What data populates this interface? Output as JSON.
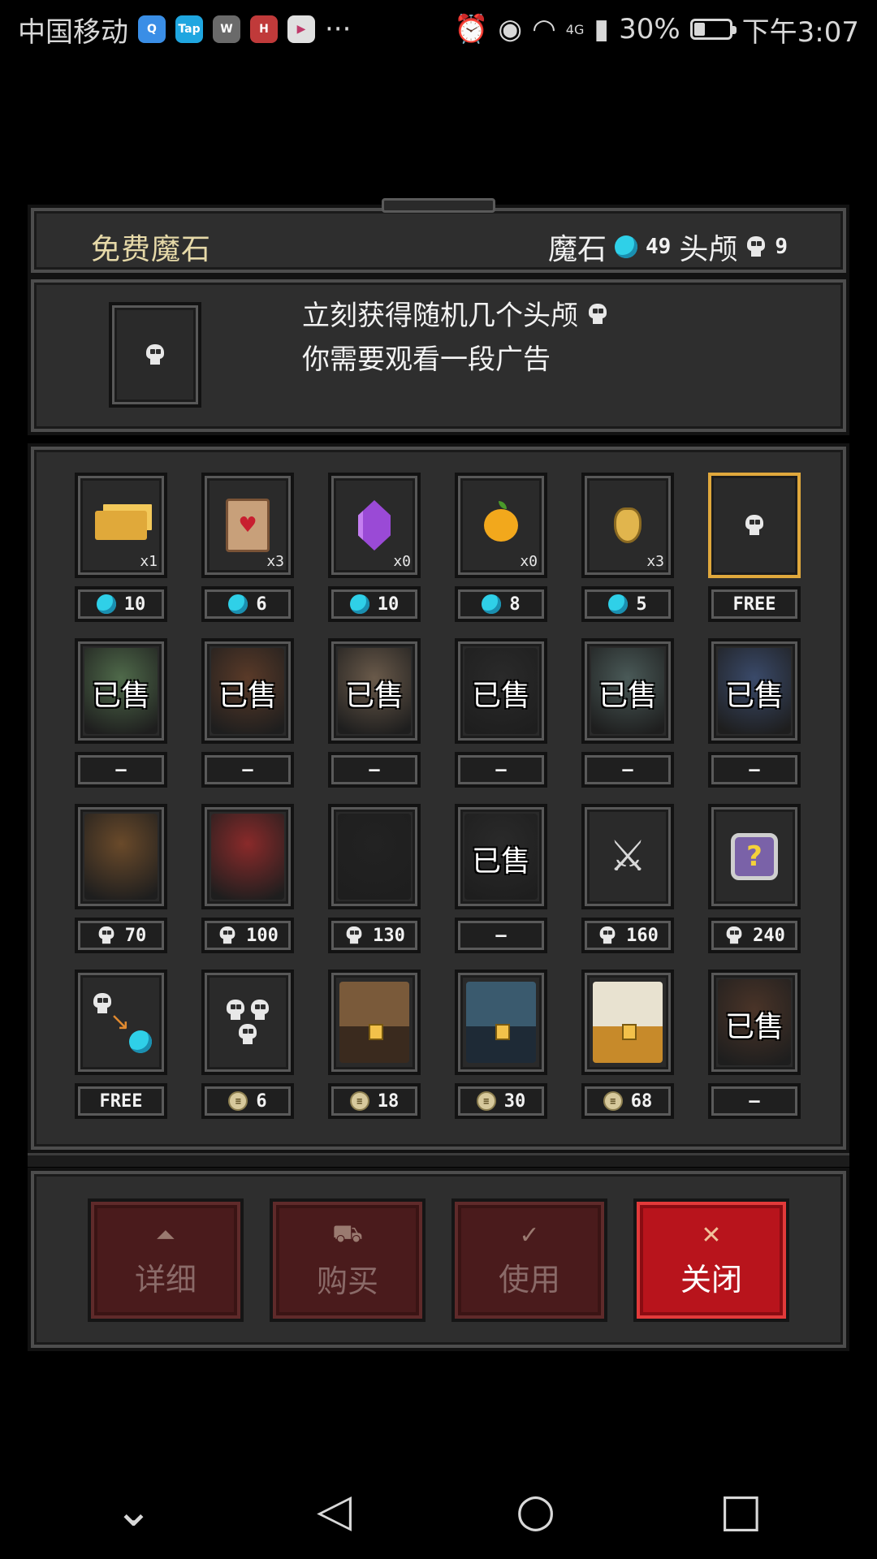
{
  "status_bar": {
    "carrier": "中国移动",
    "more": "···",
    "network": "4G",
    "battery_text": "30%",
    "battery_level": 0.3,
    "time": "下午3:07",
    "apps": [
      "qq-icon",
      "taptap-icon",
      "wechat-icon",
      "huawei-icon",
      "video-icon"
    ]
  },
  "header": {
    "title": "免费魔石",
    "gem_label": "魔石",
    "gem_count": "49",
    "skull_label": "头颅",
    "skull_count": "9"
  },
  "info": {
    "line1": "立刻获得随机几个头颅",
    "line2": "你需要观看一段广告"
  },
  "sold_label": "已售",
  "shop_rows": [
    [
      {
        "art": "gold-bars",
        "qty": "x1",
        "price_type": "gem",
        "price": "10"
      },
      {
        "art": "heart-scroll",
        "qty": "x3",
        "price_type": "gem",
        "price": "6"
      },
      {
        "art": "purple-crystal",
        "qty": "x0",
        "price_type": "gem",
        "price": "10"
      },
      {
        "art": "golden-apple",
        "qty": "x0",
        "price_type": "gem",
        "price": "8"
      },
      {
        "art": "skull-amulet",
        "qty": "x3",
        "price_type": "gem",
        "price": "5"
      },
      {
        "art": "skull",
        "qty": "",
        "price_type": "text",
        "price": "FREE",
        "selected": true
      }
    ],
    [
      {
        "art": "slime-character",
        "sold": true,
        "price_type": "text",
        "price": "—"
      },
      {
        "art": "treant-character",
        "sold": true,
        "price_type": "text",
        "price": "—"
      },
      {
        "art": "skeleton-character",
        "sold": true,
        "price_type": "text",
        "price": "—"
      },
      {
        "art": "hooded-character",
        "sold": true,
        "price_type": "text",
        "price": "—"
      },
      {
        "art": "zombie-character",
        "sold": true,
        "price_type": "text",
        "price": "—"
      },
      {
        "art": "witch-character",
        "sold": true,
        "price_type": "text",
        "price": "—"
      }
    ],
    [
      {
        "art": "forest-guardian-character",
        "price_type": "skull",
        "price": "70"
      },
      {
        "art": "vampire-girl-character",
        "price_type": "skull",
        "price": "100"
      },
      {
        "art": "reaper-character",
        "price_type": "skull",
        "price": "130"
      },
      {
        "art": "dark-mage-character",
        "sold": true,
        "price_type": "text",
        "price": "—"
      },
      {
        "art": "crossed-swords",
        "price_type": "skull",
        "price": "160"
      },
      {
        "art": "mystery-box",
        "price_type": "skull",
        "price": "240"
      }
    ],
    [
      {
        "art": "skull-to-gem",
        "price_type": "text",
        "price": "FREE"
      },
      {
        "art": "three-skulls",
        "price_type": "coin",
        "price": "6"
      },
      {
        "art": "wooden-chest",
        "price_type": "coin",
        "price": "18"
      },
      {
        "art": "blue-chest",
        "price_type": "coin",
        "price": "30"
      },
      {
        "art": "golden-chest",
        "price_type": "coin",
        "price": "68"
      },
      {
        "art": "hooded-figure-chest",
        "sold": true,
        "price_type": "text",
        "price": "—"
      }
    ]
  ],
  "buttons": [
    {
      "name": "details-button",
      "label": "详细",
      "icon": "bag-icon",
      "glyph": "⏶",
      "active": false
    },
    {
      "name": "buy-button",
      "label": "购买",
      "icon": "cart-icon",
      "glyph": "⛟",
      "active": false
    },
    {
      "name": "use-button",
      "label": "使用",
      "icon": "check-icon",
      "glyph": "✓",
      "active": false
    },
    {
      "name": "close-button",
      "label": "关闭",
      "icon": "close-icon",
      "glyph": "✕",
      "active": true
    }
  ],
  "nav": [
    {
      "name": "nav-down-button",
      "icon": "chevron-down-icon",
      "glyph": "⌄"
    },
    {
      "name": "nav-back-button",
      "icon": "back-triangle-icon",
      "glyph": "◁"
    },
    {
      "name": "nav-home-button",
      "icon": "home-circle-icon",
      "glyph": "○"
    },
    {
      "name": "nav-recents-button",
      "icon": "recents-square-icon",
      "glyph": "□"
    }
  ],
  "colors": {
    "gem": "#2fd0e8",
    "selected_border": "#e0a83c",
    "close_button": "#b8141c",
    "title_text": "#e6d9a8"
  }
}
